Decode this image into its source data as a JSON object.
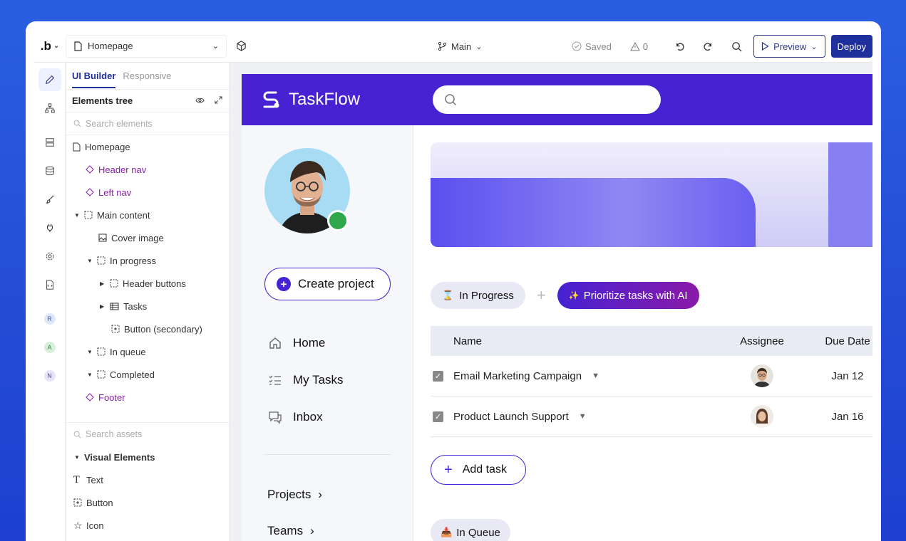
{
  "topbar": {
    "logo": ".b",
    "page": "Homepage",
    "branch": "Main",
    "saved": "Saved",
    "warnings": "0",
    "preview": "Preview",
    "deploy": "Deploy"
  },
  "rail": {
    "avatars": [
      "R",
      "A",
      "N"
    ]
  },
  "panel": {
    "tab_active": "UI Builder",
    "tab_other": "Responsive",
    "tree_title": "Elements tree",
    "search_placeholder": "Search elements",
    "tree": [
      {
        "label": "Homepage"
      },
      {
        "label": "Header nav"
      },
      {
        "label": "Left nav"
      },
      {
        "label": "Main content"
      },
      {
        "label": "Cover image"
      },
      {
        "label": "In progress"
      },
      {
        "label": "Header buttons"
      },
      {
        "label": "Tasks"
      },
      {
        "label": "Button (secondary)"
      },
      {
        "label": "In queue"
      },
      {
        "label": "Completed"
      },
      {
        "label": "Footer"
      }
    ],
    "assets_placeholder": "Search assets",
    "assets_section": "Visual Elements",
    "assets": [
      "Text",
      "Button",
      "Icon"
    ]
  },
  "app": {
    "brand": "TaskFlow",
    "create_project": "Create project",
    "nav": [
      "Home",
      "My Tasks",
      "Inbox"
    ],
    "links": [
      "Projects",
      "Teams"
    ],
    "chip_progress": "In Progress",
    "chip_ai": "Prioritize tasks with AI",
    "columns": [
      "Name",
      "Assignee",
      "Due Date"
    ],
    "rows": [
      {
        "name": "Email Marketing Campaign",
        "due": "Jan 12"
      },
      {
        "name": "Product Launch Support",
        "due": "Jan 16"
      }
    ],
    "add_task": "Add task",
    "chip_queue": "In Queue"
  }
}
